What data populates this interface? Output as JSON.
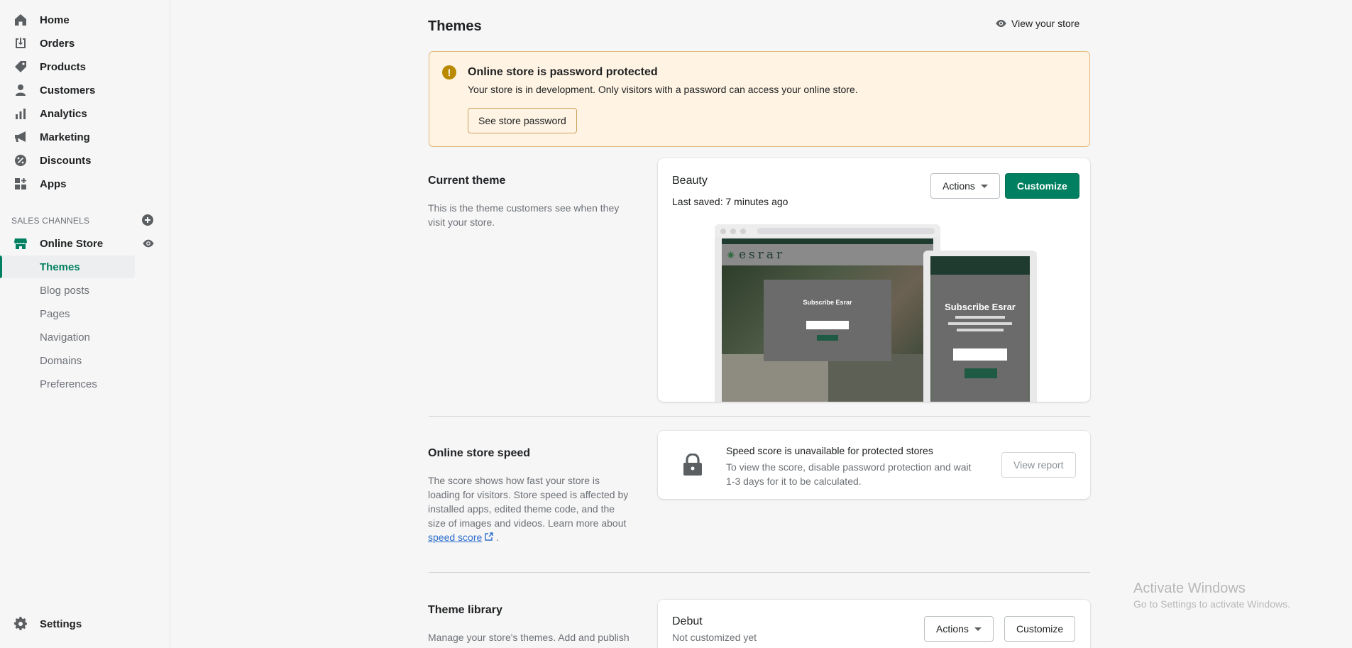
{
  "sidebar": {
    "items": [
      {
        "label": "Home",
        "icon": "home-icon"
      },
      {
        "label": "Orders",
        "icon": "orders-icon"
      },
      {
        "label": "Products",
        "icon": "tag-icon"
      },
      {
        "label": "Customers",
        "icon": "person-icon"
      },
      {
        "label": "Analytics",
        "icon": "bar-chart-icon"
      },
      {
        "label": "Marketing",
        "icon": "megaphone-icon"
      },
      {
        "label": "Discounts",
        "icon": "discount-icon"
      },
      {
        "label": "Apps",
        "icon": "apps-icon"
      }
    ],
    "sales_channels_title": "SALES CHANNELS",
    "online_store": "Online Store",
    "online_store_subitems": [
      "Themes",
      "Blog posts",
      "Pages",
      "Navigation",
      "Domains",
      "Preferences"
    ],
    "active_subitem": "Themes",
    "settings": "Settings"
  },
  "header": {
    "title": "Themes",
    "view_store": "View your store"
  },
  "banner": {
    "title": "Online store is password protected",
    "text": "Your store is in development. Only visitors with a password can access your online store.",
    "button": "See store password"
  },
  "current_theme": {
    "section_title": "Current theme",
    "section_desc": "This is the theme customers see when they visit your store.",
    "theme_name": "Beauty",
    "last_saved": "Last saved: 7 minutes ago",
    "actions_label": "Actions",
    "customize_label": "Customize",
    "preview": {
      "logo": "esrar",
      "modal_title_desktop": "Subscribe Esrar",
      "modal_title_mobile": "Subscribe Esrar"
    }
  },
  "speed": {
    "section_title": "Online store speed",
    "section_desc": "The score shows how fast your store is loading for visitors. Store speed is affected by installed apps, edited theme code, and the size of images and videos. Learn more about",
    "link_text": "speed score",
    "desc_end": ".",
    "card_title": "Speed score is unavailable for protected stores",
    "card_text": "To view the score, disable password protection and wait 1-3 days for it to be calculated.",
    "button": "View report"
  },
  "library": {
    "section_title": "Theme library",
    "section_desc": "Manage your store's themes. Add and publish",
    "theme_name": "Debut",
    "theme_status": "Not customized yet",
    "actions_label": "Actions",
    "customize_label": "Customize"
  },
  "watermark": {
    "line1": "Activate Windows",
    "line2": "Go to Settings to activate Windows."
  },
  "colors": {
    "accent": "#008060",
    "banner_bg": "#fff4e4",
    "banner_border": "#e1b878",
    "warning_icon": "#b98900"
  }
}
